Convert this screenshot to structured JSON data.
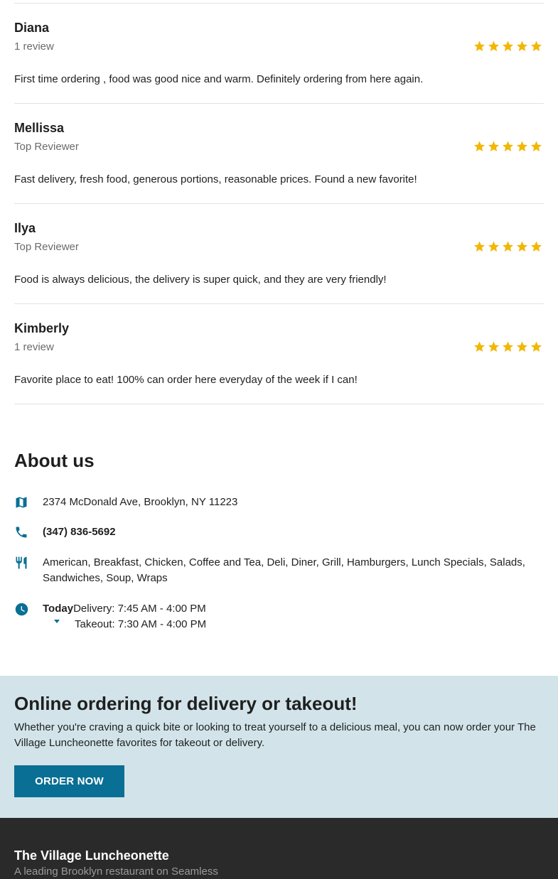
{
  "reviews": [
    {
      "name": "Diana",
      "subtitle": "1 review",
      "rating": 5,
      "text": "First time ordering , food was good nice and warm. Definitely ordering from here again."
    },
    {
      "name": "Mellissa",
      "subtitle": "Top Reviewer",
      "rating": 5,
      "text": "Fast delivery, fresh food, generous portions, reasonable prices. Found a new favorite!"
    },
    {
      "name": "Ilya",
      "subtitle": "Top Reviewer",
      "rating": 5,
      "text": "Food is always delicious, the delivery is super quick, and they are very friendly!"
    },
    {
      "name": "Kimberly",
      "subtitle": "1 review",
      "rating": 5,
      "text": "Favorite place to eat! 100% can order here everyday of the week if I can!"
    }
  ],
  "about": {
    "title": "About us",
    "address": "2374 McDonald Ave, Brooklyn, NY 11223",
    "phone": "(347) 836-5692",
    "cuisines": "American, Breakfast, Chicken, Coffee and Tea, Deli, Diner, Grill, Hamburgers, Lunch Specials, Salads, Sandwiches, Soup, Wraps",
    "hours": {
      "today_label": "Today",
      "delivery": "Delivery: 7:45 AM - 4:00 PM",
      "takeout": "Takeout: 7:30 AM - 4:00 PM"
    },
    "icons": {
      "address": "map-icon",
      "phone": "phone-icon",
      "cuisines": "utensils-icon",
      "hours": "clock-icon",
      "expand": "caret-down-icon"
    }
  },
  "cta": {
    "title": "Online ordering for delivery or takeout!",
    "text": "Whether you're craving a quick bite or looking to treat yourself to a delicious meal, you can now order your The Village Luncheonette favorites for takeout or delivery.",
    "button_label": "ORDER NOW"
  },
  "footer": {
    "title": "The Village Luncheonette",
    "subtitle": "A leading Brooklyn restaurant on Seamless"
  },
  "colors": {
    "accent": "#0a6f94",
    "star": "#f2b705",
    "cta_background": "#d2e4ea",
    "footer_background": "#2a2a2a"
  }
}
